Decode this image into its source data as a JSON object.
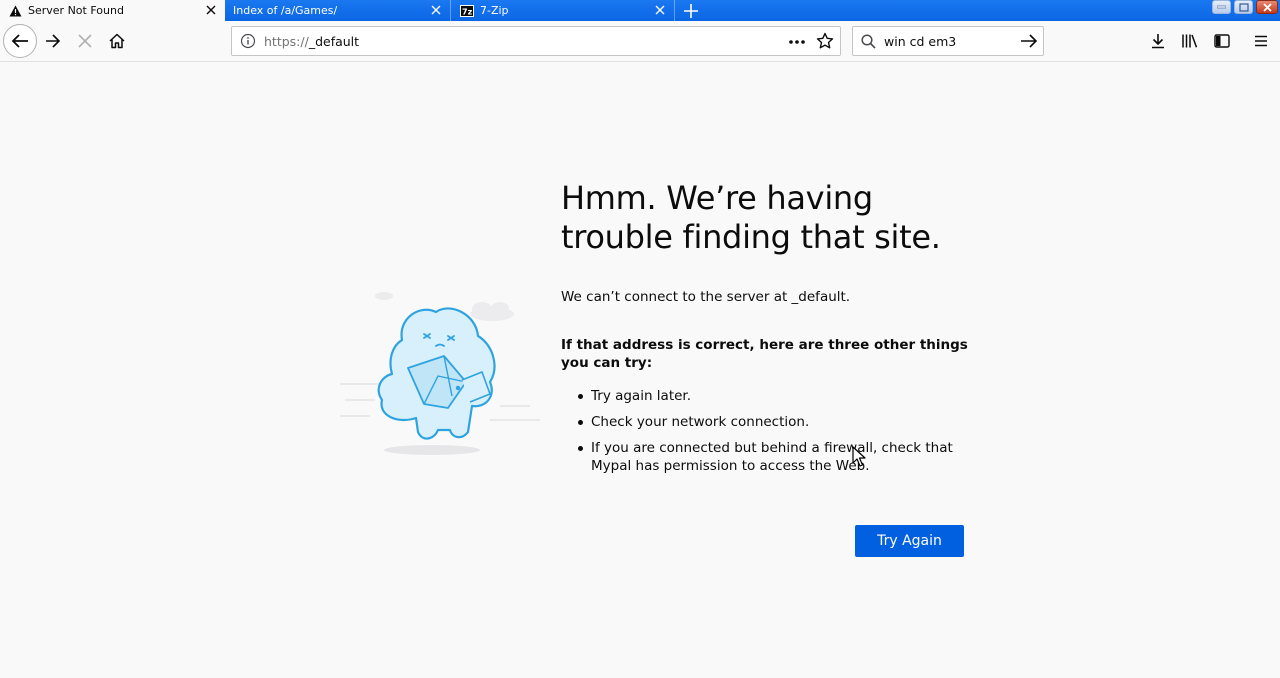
{
  "tabs": [
    {
      "label": "Server Not Found",
      "icon": "warning-icon",
      "active": true
    },
    {
      "label": "Index of /a/Games/",
      "icon": "none",
      "active": false
    },
    {
      "label": "7-Zip",
      "icon": "7zip-icon",
      "active": false
    }
  ],
  "tab_icon_text": "7z",
  "navbar": {
    "url_protocol": "https://",
    "url_host": "_default",
    "search_text": "win cd em3"
  },
  "error": {
    "title": "Hmm. We’re having trouble finding that site.",
    "description": "We can’t connect to the server at _default.",
    "suggestions_heading": "If that address is correct, here are three other things you can try:",
    "suggestions": [
      "Try again later.",
      "Check your network connection.",
      "If you are connected but behind a firewall, check that Mypal has permission to access the Web."
    ],
    "try_again_label": "Try Again"
  },
  "colors": {
    "tabstrip": "#0b66e4",
    "primary_button": "#0060df",
    "page_background": "#f9f9fa",
    "illustration_blue": "#2ea3e0"
  }
}
